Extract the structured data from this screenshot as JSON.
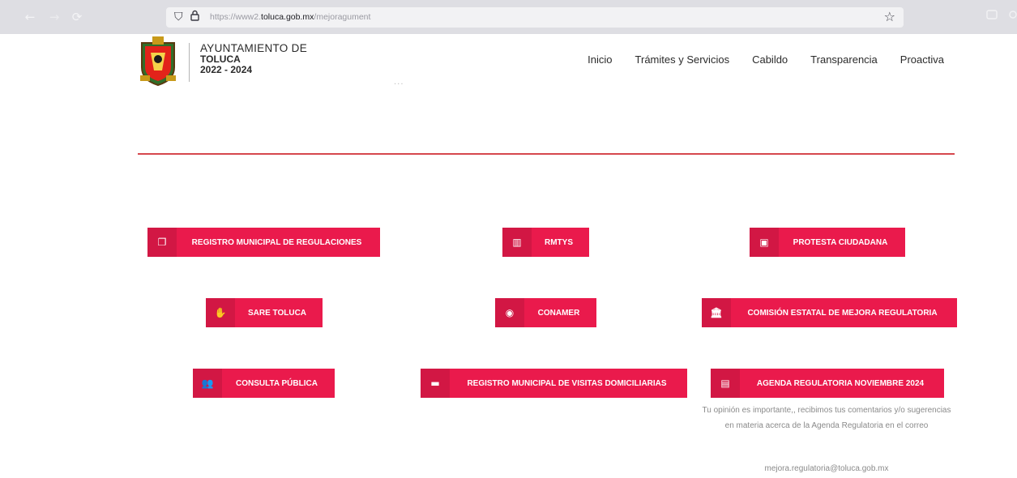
{
  "browser": {
    "back_icon": "←",
    "forward_icon": "→",
    "reload_icon": "⟳",
    "shield_icon": "⛉",
    "lock_icon": "🔒",
    "url_prefix": "https://www2.",
    "url_domain": "toluca.gob.mx",
    "url_path": "/mejoragument",
    "star_icon": "☆"
  },
  "header": {
    "brand_line1": "AYUNTAMIENTO DE",
    "brand_line2": "TOLUCA",
    "brand_line3": "2022 - 2024",
    "nav": [
      "Inicio",
      "Trámites y Servicios",
      "Cabildo",
      "Transparencia",
      "Proactiva"
    ],
    "dots": "···"
  },
  "buttons": {
    "registro_regulaciones": {
      "label": "REGISTRO MUNICIPAL DE REGULACIONES",
      "icon": "❐"
    },
    "rmtys": {
      "label": "RMTYS",
      "icon": "▥"
    },
    "protesta": {
      "label": "PROTESTA CIUDADANA",
      "icon": "▣"
    },
    "sare": {
      "label": "SARE TOLUCA",
      "icon": "✋"
    },
    "conamer": {
      "label": "CONAMER",
      "icon": "◉"
    },
    "comision": {
      "label": "COMISIÓN ESTATAL DE MEJORA REGULATORIA",
      "icon": "🏛"
    },
    "consulta": {
      "label": "CONSULTA PÚBLICA",
      "icon": "👥"
    },
    "visitas": {
      "label": "REGISTRO MUNICIPAL DE VISITAS DOMICILIARIAS",
      "icon": "▬"
    },
    "agenda": {
      "label": "AGENDA REGULATORIA NOVIEMBRE 2024",
      "icon": "▤"
    }
  },
  "agenda_note": {
    "text": "Tu opinión es importante,, recibimos tus comentarios y/o sugerencias en materia acerca de la Agenda Regulatoria  en el correo",
    "email": "mejora.regulatoria@toluca.gob.mx"
  },
  "colors": {
    "accent": "#ea1a4c",
    "divider": "#d6474d",
    "chrome": "#dedee3"
  }
}
